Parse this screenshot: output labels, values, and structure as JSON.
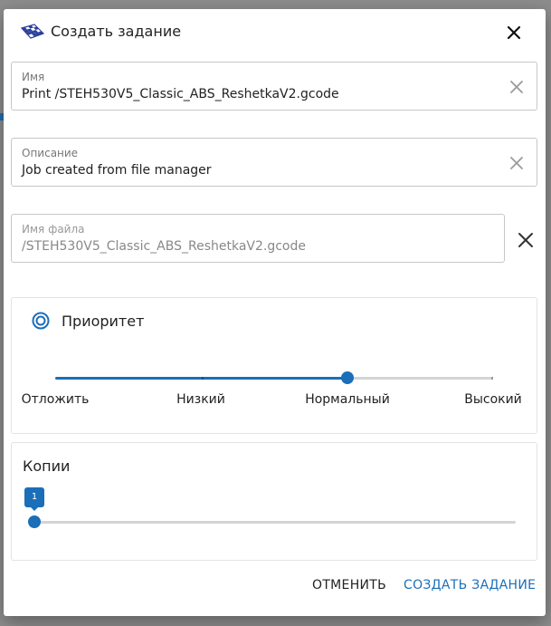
{
  "dialog": {
    "title": "Создать задание",
    "logo_icon": "checkered-plate-logo",
    "close_icon": "close-icon"
  },
  "fields": {
    "name": {
      "label": "Имя",
      "value": "Print /STEH530V5_Classic_ABS_ReshetkaV2.gcode"
    },
    "description": {
      "label": "Описание",
      "value": "Job created from file manager"
    },
    "filename": {
      "label": "Имя файла",
      "value": "/STEH530V5_Classic_ABS_ReshetkaV2.gcode",
      "disabled": true
    }
  },
  "priority": {
    "title": "Приоритет",
    "selected": "Нормальный",
    "levels": [
      "Отложить",
      "Низкий",
      "Нормальный",
      "Высокий"
    ]
  },
  "copies": {
    "title": "Копии",
    "value": "1",
    "min_fraction": 0.0
  },
  "actions": {
    "cancel": "ОТМЕНИТЬ",
    "create": "СОЗДАТЬ ЗАДАНИЕ"
  },
  "colors": {
    "accent": "#1b6eb8",
    "text": "#222222",
    "border": "#c7c7c7"
  }
}
